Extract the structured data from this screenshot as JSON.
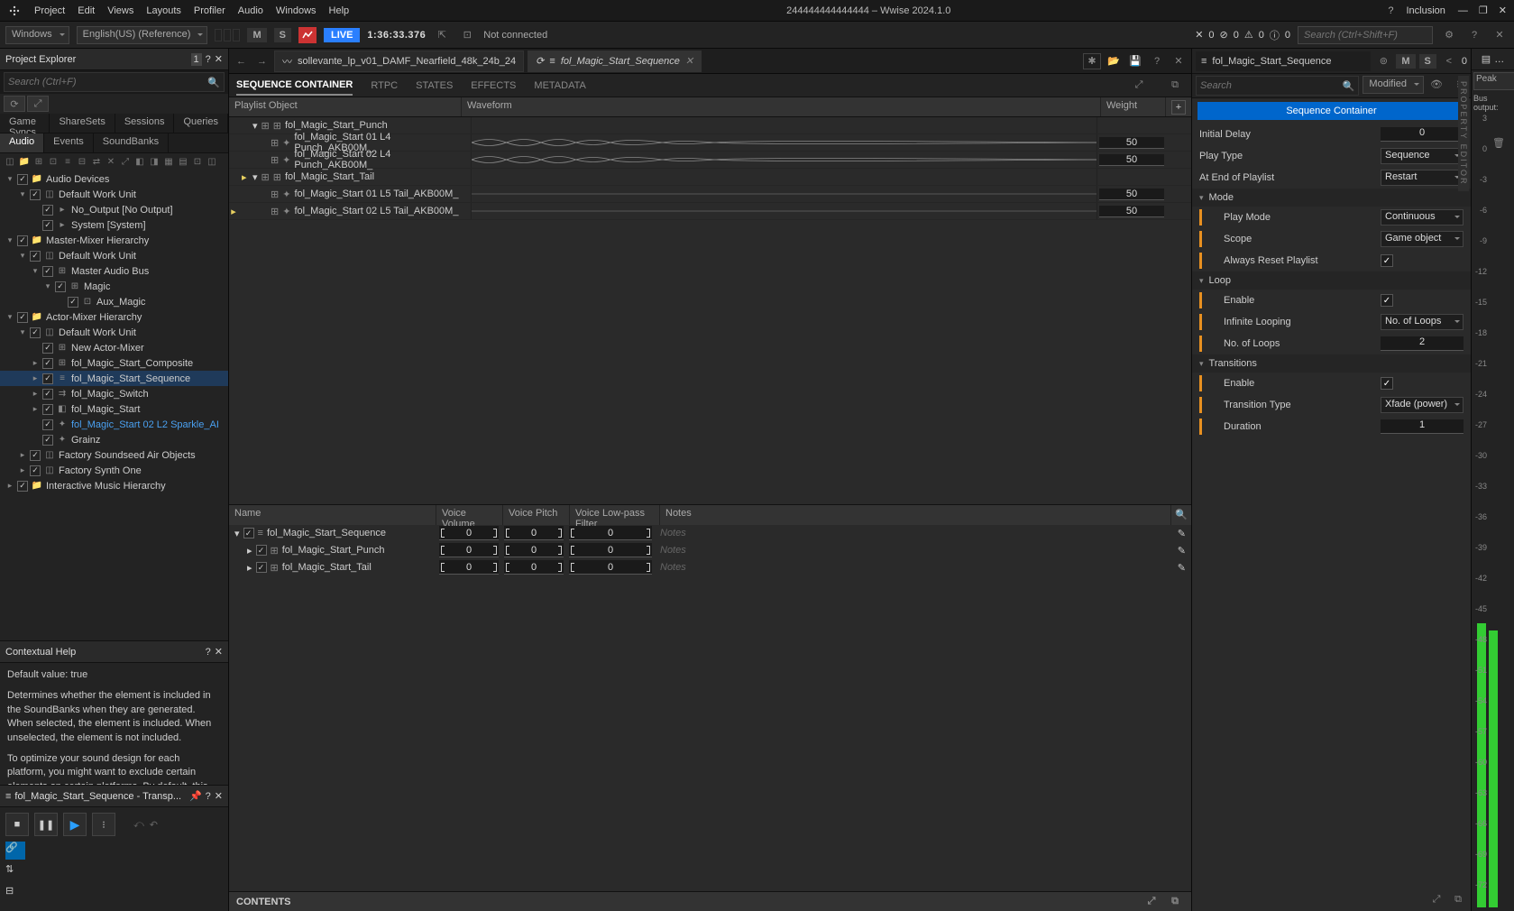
{
  "app": {
    "title": "244444444444444 – Wwise 2024.1.0",
    "menus": [
      "Project",
      "Edit",
      "Views",
      "Layouts",
      "Profiler",
      "Audio",
      "Windows",
      "Help"
    ],
    "inclusion": "Inclusion"
  },
  "toolbar": {
    "layout": "Windows",
    "lang": "English(US) (Reference)",
    "M": "M",
    "S": "S",
    "live": "LIVE",
    "tc": "1:36:33.376",
    "conn": "Not connected",
    "search_ph": "Search (Ctrl+Shift+F)",
    "counts": [
      "0",
      "0",
      "0",
      "0"
    ]
  },
  "explorer": {
    "title": "Project Explorer",
    "search_ph": "Search (Ctrl+F)",
    "tabs1": [
      "Game Syncs",
      "ShareSets",
      "Sessions",
      "Queries"
    ],
    "tabs2": [
      "Audio",
      "Events",
      "SoundBanks"
    ],
    "tree": [
      {
        "d": 0,
        "exp": "▾",
        "ic": "📁",
        "lbl": "Audio Devices"
      },
      {
        "d": 1,
        "exp": "▾",
        "ic": "◫",
        "lbl": "Default Work Unit"
      },
      {
        "d": 2,
        "exp": "",
        "ic": "▸",
        "lbl": "No_Output [No Output]"
      },
      {
        "d": 2,
        "exp": "",
        "ic": "▸",
        "lbl": "System [System]"
      },
      {
        "d": 0,
        "exp": "▾",
        "ic": "📁",
        "lbl": "Master-Mixer Hierarchy"
      },
      {
        "d": 1,
        "exp": "▾",
        "ic": "◫",
        "lbl": "Default Work Unit"
      },
      {
        "d": 2,
        "exp": "▾",
        "ic": "⊞",
        "lbl": "Master Audio Bus"
      },
      {
        "d": 3,
        "exp": "▾",
        "ic": "⊞",
        "lbl": "Magic"
      },
      {
        "d": 4,
        "exp": "",
        "ic": "⊡",
        "lbl": "Aux_Magic"
      },
      {
        "d": 0,
        "exp": "▾",
        "ic": "📁",
        "lbl": "Actor-Mixer Hierarchy"
      },
      {
        "d": 1,
        "exp": "▾",
        "ic": "◫",
        "lbl": "Default Work Unit"
      },
      {
        "d": 2,
        "exp": "",
        "ic": "⊞",
        "lbl": "New Actor-Mixer"
      },
      {
        "d": 2,
        "exp": "▸",
        "ic": "⊞",
        "lbl": "fol_Magic_Start_Composite"
      },
      {
        "d": 2,
        "exp": "▸",
        "ic": "≡",
        "lbl": "fol_Magic_Start_Sequence",
        "sel": true
      },
      {
        "d": 2,
        "exp": "▸",
        "ic": "⇉",
        "lbl": "fol_Magic_Switch"
      },
      {
        "d": 2,
        "exp": "▸",
        "ic": "◧",
        "lbl": "fol_Magic_Start"
      },
      {
        "d": 2,
        "exp": "",
        "ic": "✦",
        "lbl": "fol_Magic_Start 02 L2 Sparkle_AI",
        "blue": true
      },
      {
        "d": 2,
        "exp": "",
        "ic": "✦",
        "lbl": "Grainz"
      },
      {
        "d": 1,
        "exp": "▸",
        "ic": "◫",
        "lbl": "Factory Soundseed Air Objects"
      },
      {
        "d": 1,
        "exp": "▸",
        "ic": "◫",
        "lbl": "Factory Synth One"
      },
      {
        "d": 0,
        "exp": "▸",
        "ic": "📁",
        "lbl": "Interactive Music Hierarchy"
      }
    ]
  },
  "help": {
    "title": "Contextual Help",
    "line1": "Default value: true",
    "body": "Determines whether the element is included in the SoundBanks when they are generated. When selected, the element is included. When unselected, the element is not included.",
    "body2": "To optimize your sound design for each platform, you might want to exclude certain elements on certain platforms. By default, this check box"
  },
  "transport": {
    "title": "fol_Magic_Start_Sequence - Transp..."
  },
  "doctabs": {
    "t1": "sollevante_lp_v01_DAMF_Nearfield_48k_24b_24",
    "t2": "fol_Magic_Start_Sequence"
  },
  "editor": {
    "tabs": [
      "SEQUENCE CONTAINER",
      "RTPC",
      "STATES",
      "EFFECTS",
      "METADATA"
    ],
    "cols": {
      "obj": "Playlist Object",
      "wave": "Waveform",
      "wt": "Weight"
    },
    "rows": [
      {
        "d": 0,
        "exp": "▾",
        "ic": "⊞",
        "lbl": "fol_Magic_Start_Punch",
        "wt": ""
      },
      {
        "d": 1,
        "exp": "",
        "ic": "✦",
        "lbl": "fol_Magic_Start 01 L4 Punch_AKB00M_",
        "wt": "50",
        "wave": true
      },
      {
        "d": 1,
        "exp": "",
        "ic": "✦",
        "lbl": "fol_Magic_Start 02 L4 Punch_AKB00M_",
        "wt": "50",
        "wave": true
      },
      {
        "d": 0,
        "exp": "▾",
        "ic": "⊞",
        "lbl": "fol_Magic_Start_Tail",
        "wt": "",
        "yar": "▸"
      },
      {
        "d": 1,
        "exp": "",
        "ic": "✦",
        "lbl": "fol_Magic_Start 01 L5 Tail_AKB00M_",
        "wt": "50",
        "flat": true
      },
      {
        "d": 1,
        "exp": "",
        "ic": "✦",
        "lbl": "fol_Magic_Start 02 L5 Tail_AKB00M_",
        "wt": "50",
        "flat": true,
        "play": "▸"
      }
    ]
  },
  "contents": {
    "title": "CONTENTS",
    "cols": [
      "Name",
      "Voice Volume",
      "Voice Pitch",
      "Voice Low-pass Filter",
      "Notes"
    ],
    "rows": [
      {
        "d": 0,
        "exp": "▾",
        "ic": "≡",
        "lbl": "fol_Magic_Start_Sequence",
        "vv": "0",
        "vp": "0",
        "vl": "0",
        "notes": "Notes"
      },
      {
        "d": 1,
        "exp": "▸",
        "ic": "⊞",
        "lbl": "fol_Magic_Start_Punch",
        "vv": "0",
        "vp": "0",
        "vl": "0",
        "notes": "Notes"
      },
      {
        "d": 1,
        "exp": "▸",
        "ic": "⊞",
        "lbl": "fol_Magic_Start_Tail",
        "vv": "0",
        "vp": "0",
        "vl": "0",
        "notes": "Notes"
      }
    ]
  },
  "props": {
    "name": "fol_Magic_Start_Sequence",
    "M": "M",
    "S": "S",
    "zero": "0",
    "search_ph": "Search",
    "modified": "Modified",
    "header": "Sequence Container",
    "rows": [
      {
        "lbl": "Initial Delay",
        "type": "num",
        "val": "0"
      },
      {
        "lbl": "Play Type",
        "type": "dd",
        "val": "Sequence"
      },
      {
        "lbl": "At End of Playlist",
        "type": "dd",
        "val": "Restart"
      }
    ],
    "mode": {
      "hdr": "Mode",
      "rows": [
        {
          "lbl": "Play Mode",
          "type": "dd",
          "val": "Continuous",
          "o": 1
        },
        {
          "lbl": "Scope",
          "type": "dd",
          "val": "Game object",
          "o": 1
        },
        {
          "lbl": "Always Reset Playlist",
          "type": "chk",
          "val": true,
          "o": 1
        }
      ]
    },
    "loop": {
      "hdr": "Loop",
      "rows": [
        {
          "lbl": "Enable",
          "type": "chk",
          "val": true,
          "o": 1
        },
        {
          "lbl": "Infinite Looping",
          "type": "dd",
          "val": "No. of Loops",
          "o": 1
        },
        {
          "lbl": "No. of Loops",
          "type": "num",
          "val": "2",
          "o": 1
        }
      ]
    },
    "trans": {
      "hdr": "Transitions",
      "rows": [
        {
          "lbl": "Enable",
          "type": "chk",
          "val": true,
          "o": 1
        },
        {
          "lbl": "Transition Type",
          "type": "dd",
          "val": "Xfade (power)",
          "o": 1
        },
        {
          "lbl": "Duration",
          "type": "num",
          "val": "1",
          "o": 1
        }
      ]
    },
    "side": "PROPERTY EDITOR"
  },
  "meters": {
    "peak": "Peak",
    "label": "Bus output:",
    "ticks": [
      "3",
      "0",
      "-3",
      "-6",
      "-9",
      "-12",
      "-15",
      "-18",
      "-21",
      "-24",
      "-27",
      "-30",
      "-33",
      "-36",
      "-39",
      "-42",
      "-45",
      "-48",
      "-51",
      "-54",
      "-57",
      "-60",
      "-63",
      "-66",
      "-69",
      "-72"
    ]
  }
}
